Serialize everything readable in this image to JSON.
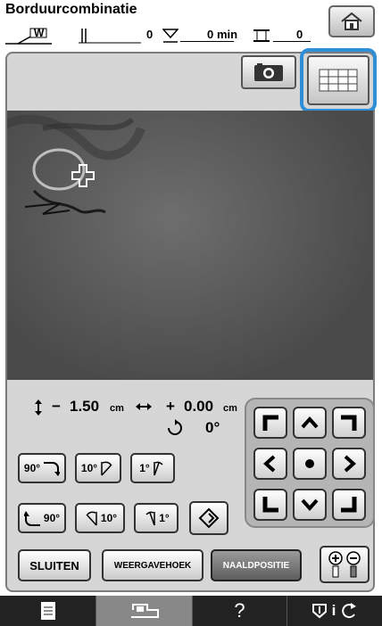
{
  "app": {
    "title": "Borduurcombinatie"
  },
  "status": {
    "presser_label": "W",
    "stitch_count": "0",
    "time_value": "0",
    "time_unit": "min",
    "color_count": "0"
  },
  "offsets": {
    "vertical_sign": "−",
    "vertical_value": "1.50",
    "vertical_unit": "cm",
    "horizontal_sign": "+",
    "horizontal_value": "0.00",
    "horizontal_unit": "cm",
    "rotation_value": "0°"
  },
  "rotate_buttons": {
    "r90": "90°",
    "r10": "10°",
    "r1": "1°",
    "l90": "90°",
    "l10": "10°",
    "l1": "1°"
  },
  "bottom": {
    "close": "SLUITEN",
    "view_angle": "WEERGAVEHOEK",
    "needle_position": "NAALDPOSITIE"
  },
  "navbar": {
    "help": "?",
    "info": "i"
  },
  "colors": {
    "highlight": "#2f8fd6",
    "panel": "#d6d6d6",
    "navbar": "#222222"
  }
}
